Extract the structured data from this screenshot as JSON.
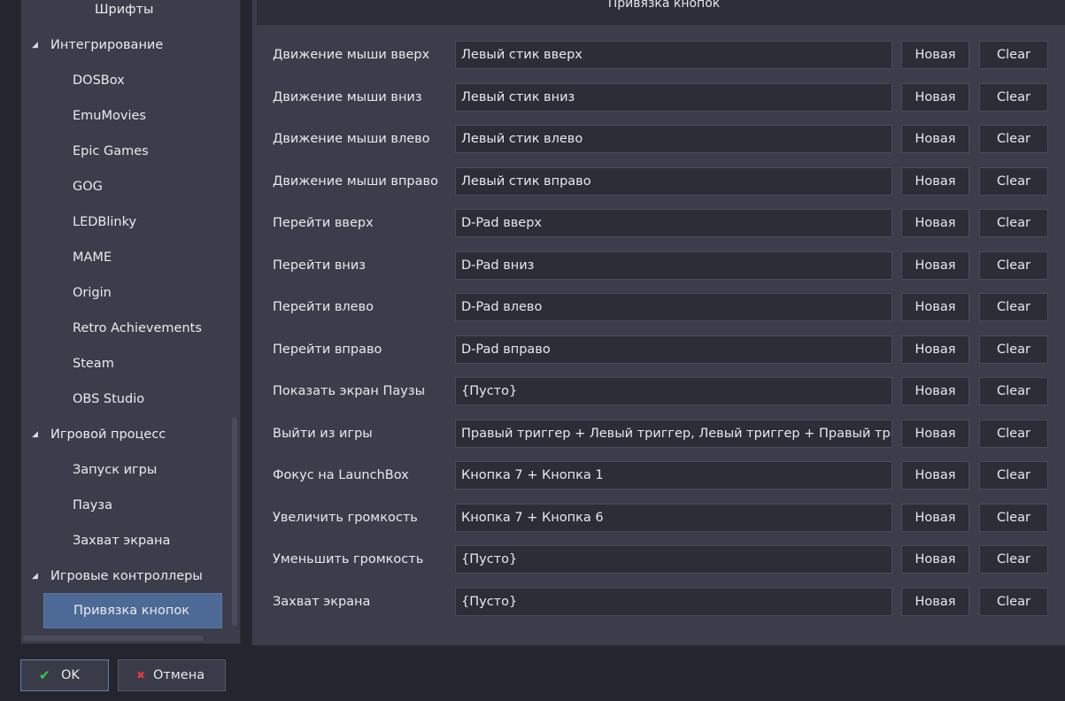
{
  "sidebar": {
    "top_item": "Шрифты",
    "groups": [
      {
        "label": "Интегрирование",
        "children": [
          "DOSBox",
          "EmuMovies",
          "Epic Games",
          "GOG",
          "LEDBlinky",
          "MAME",
          "Origin",
          "Retro Achievements",
          "Steam",
          "OBS Studio"
        ]
      },
      {
        "label": "Игровой процесс",
        "children": [
          "Запуск игры",
          "Пауза",
          "Захват экрана"
        ]
      },
      {
        "label": "Игровые контроллеры",
        "children": [
          "Привязка кнопок"
        ]
      }
    ],
    "selected": "Привязка кнопок"
  },
  "main": {
    "title": "Привязка кнопок",
    "new_label": "Новая",
    "clear_label": "Clear",
    "bindings": [
      {
        "label": "Движение мыши вверх",
        "value": "Левый стик вверх"
      },
      {
        "label": "Движение мыши вниз",
        "value": "Левый стик вниз"
      },
      {
        "label": "Движение мыши влево",
        "value": "Левый стик влево"
      },
      {
        "label": "Движение мыши вправо",
        "value": "Левый стик вправо"
      },
      {
        "label": "Перейти вверх",
        "value": "D-Pad вверх"
      },
      {
        "label": "Перейти вниз",
        "value": "D-Pad вниз"
      },
      {
        "label": "Перейти влево",
        "value": "D-Pad влево"
      },
      {
        "label": "Перейти вправо",
        "value": "D-Pad вправо"
      },
      {
        "label": "Показать экран Паузы",
        "value": "{Пусто}"
      },
      {
        "label": "Выйти из игры",
        "value": "Правый триггер + Левый триггер, Левый триггер + Правый триггер, П"
      },
      {
        "label": "Фокус на LaunchBox",
        "value": "Кнопка 7 + Кнопка 1"
      },
      {
        "label": "Увеличить громкость",
        "value": "Кнопка 7 + Кнопка 6"
      },
      {
        "label": "Уменьшить громкость",
        "value": "{Пусто}"
      },
      {
        "label": "Захват экрана",
        "value": "{Пусто}"
      }
    ]
  },
  "footer": {
    "ok_label": "OK",
    "cancel_label": "Отмена",
    "ok_icon": "check-icon",
    "cancel_icon": "cancel-icon"
  }
}
